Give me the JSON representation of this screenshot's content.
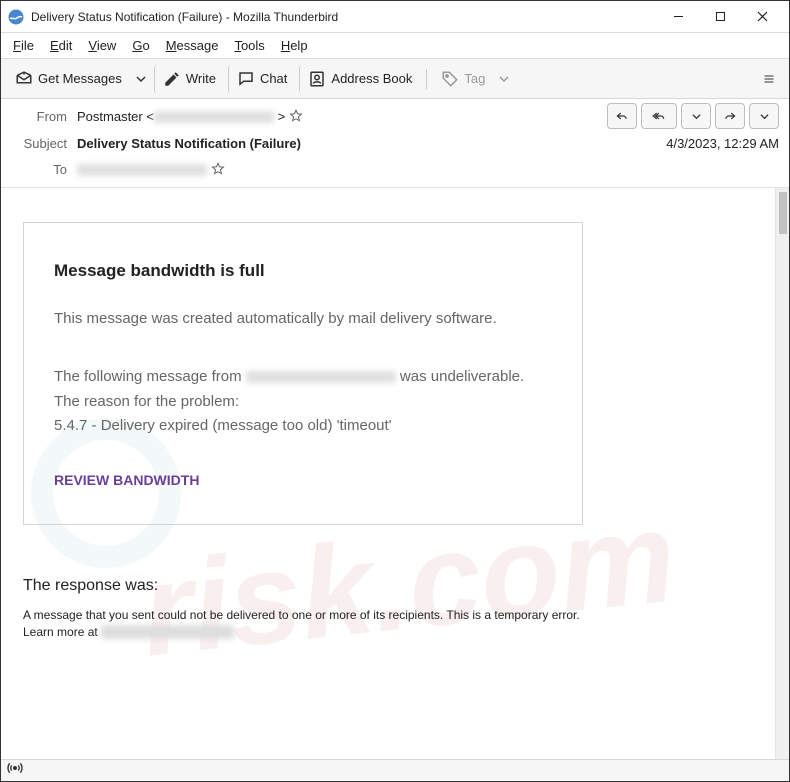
{
  "window": {
    "title": "Delivery Status Notification (Failure) - Mozilla Thunderbird"
  },
  "menu": {
    "file": "File",
    "edit": "Edit",
    "view": "View",
    "go": "Go",
    "message": "Message",
    "tools": "Tools",
    "help": "Help"
  },
  "toolbar": {
    "get_messages": "Get Messages",
    "write": "Write",
    "chat": "Chat",
    "address_book": "Address Book",
    "tag": "Tag"
  },
  "header": {
    "from_label": "From",
    "from_name": "Postmaster <",
    "from_close": " >",
    "subject_label": "Subject",
    "subject_value": "Delivery Status Notification (Failure)",
    "to_label": "To",
    "date": "4/3/2023, 12:29 AM"
  },
  "body": {
    "heading": "Message bandwidth is full",
    "line1": "This message was created automatically by mail delivery software.",
    "line2a": "The following message from ",
    "line2b": " was undeliverable.",
    "line3": " The reason for the problem:",
    "line4": " 5.4.7 - Delivery expired (message too old) 'timeout'",
    "link": "REVIEW BANDWIDTH",
    "response_head": "The response was:",
    "response_body_a": "A message that you sent could not be delivered to one or more of its recipients. This is a temporary error.\nLearn more at ",
    "response_body_b": "                                        "
  }
}
